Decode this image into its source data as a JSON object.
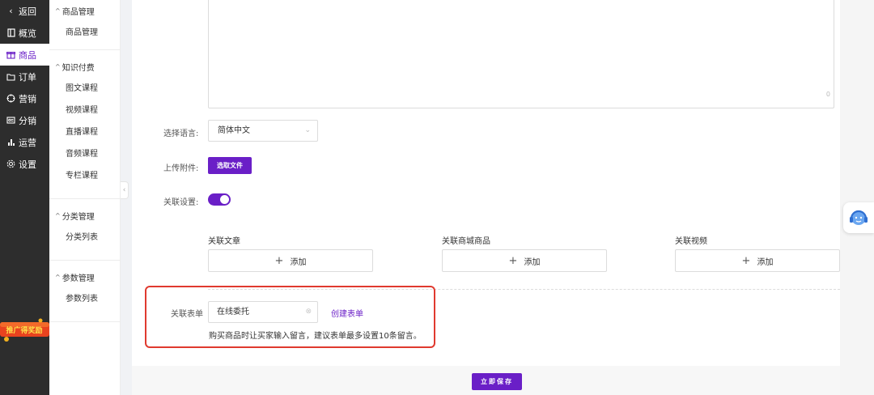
{
  "nav": {
    "items": [
      {
        "icon": "chevron-left-icon",
        "label": "返回"
      },
      {
        "icon": "overview-icon",
        "label": "概览"
      },
      {
        "icon": "gift-icon",
        "label": "商品",
        "active": true
      },
      {
        "icon": "folder-icon",
        "label": "订单"
      },
      {
        "icon": "target-icon",
        "label": "营销"
      },
      {
        "icon": "share-icon",
        "label": "分销"
      },
      {
        "icon": "bar-chart-icon",
        "label": "运营"
      },
      {
        "icon": "gear-icon",
        "label": "设置"
      }
    ],
    "promo_text": "推广得奖励"
  },
  "subnav": {
    "groups": [
      {
        "title": "商品管理",
        "links": [
          "商品管理"
        ]
      },
      {
        "title": "知识付费",
        "links": [
          "图文课程",
          "视频课程",
          "直播课程",
          "音频课程",
          "专栏课程"
        ]
      },
      {
        "title": "分类管理",
        "links": [
          "分类列表"
        ]
      },
      {
        "title": "参数管理",
        "links": [
          "参数列表"
        ]
      }
    ]
  },
  "form": {
    "textarea_count": "0",
    "language_label": "选择语言:",
    "language_value": "简体中文",
    "upload_label": "上传附件:",
    "upload_button": "选取文件",
    "relation_label": "关联设置:",
    "relation_enabled": true,
    "relations": [
      {
        "title": "关联文章",
        "add_label": "添加"
      },
      {
        "title": "关联商城商品",
        "add_label": "添加"
      },
      {
        "title": "关联视频",
        "add_label": "添加"
      }
    ],
    "form_label": "关联表单",
    "form_value": "在线委托",
    "create_form_link": "创建表单",
    "form_hint": "购买商品时让买家输入留言，建议表单最多设置10条留言。"
  },
  "footer": {
    "save_label": "立即保存"
  },
  "colors": {
    "accent": "#6a1fc7",
    "highlight": "#e03a2f",
    "nav_bg": "#2d2d2d"
  }
}
